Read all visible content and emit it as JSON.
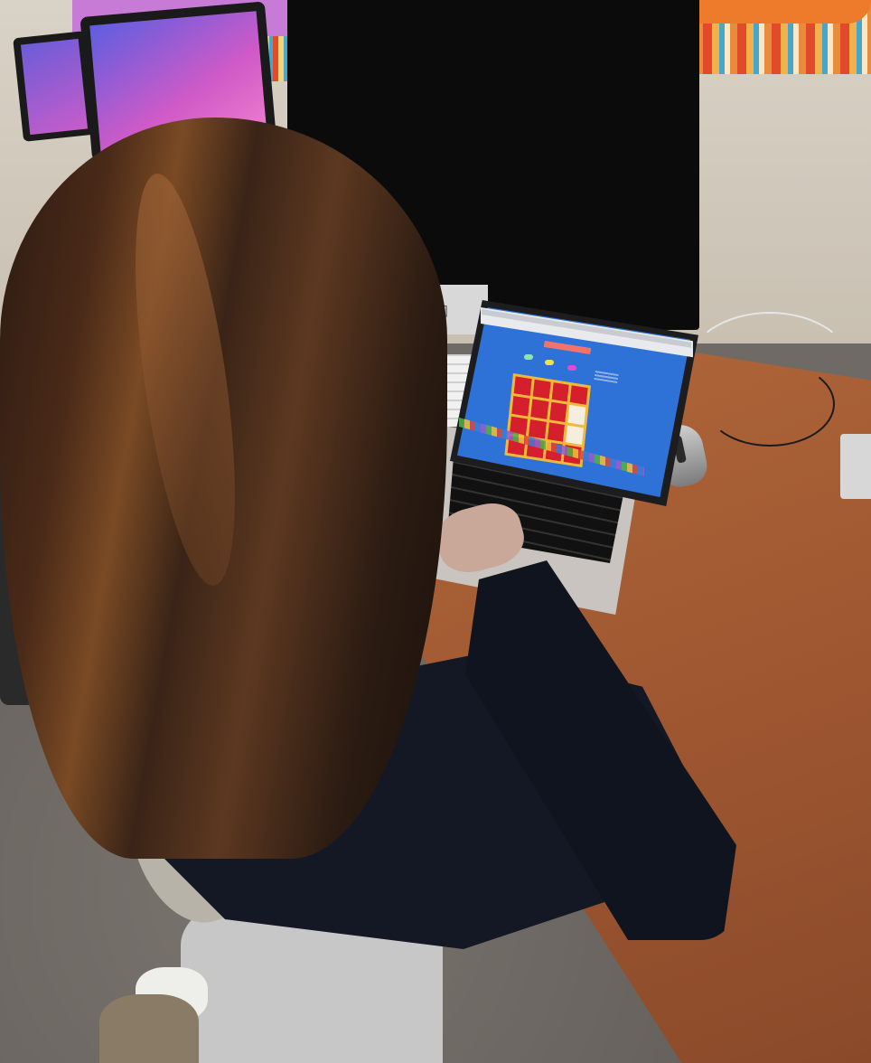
{
  "scene": {
    "description_colors": {
      "wall": "#d9d2c6",
      "desk": "#9c5530",
      "game_background": "#2e72d8",
      "game_tiles": "#d61f2c",
      "grid_frame": "#f0b93a"
    }
  },
  "laptop_screen": {
    "game": {
      "buttons": [
        {
          "color": "#8fe3b0"
        },
        {
          "color": "#f2e14a"
        },
        {
          "color": "#e04bd6"
        }
      ],
      "grid": {
        "rows": 4,
        "cols": 4,
        "flipped_tiles": [
          7,
          11
        ]
      }
    }
  },
  "icons": {
    "apple": "apple-logo-icon"
  }
}
